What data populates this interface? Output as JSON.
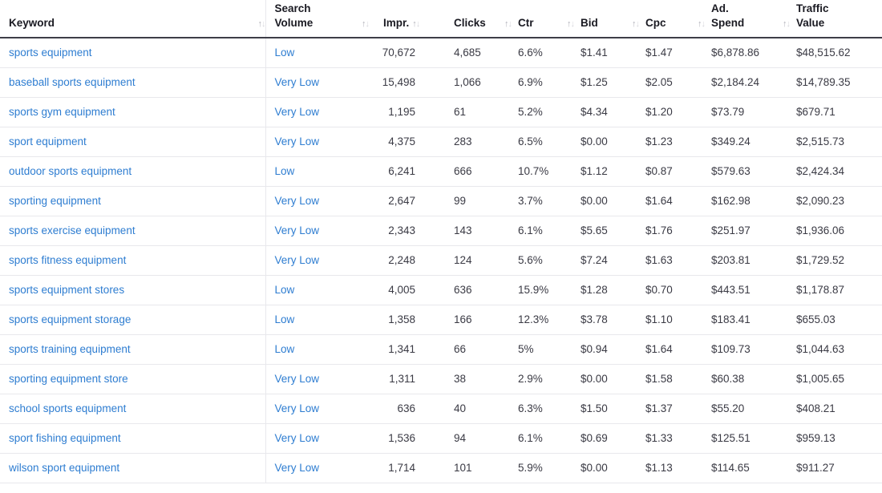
{
  "table": {
    "sort_icon": "↑↓",
    "columns": [
      {
        "key": "keyword",
        "label": "Keyword",
        "label_line1": "Keyword",
        "label_line2": ""
      },
      {
        "key": "volume",
        "label": "Search Volume",
        "label_line1": "Search",
        "label_line2": "Volume"
      },
      {
        "key": "impr",
        "label": "Impr.",
        "label_line1": "Impr.",
        "label_line2": ""
      },
      {
        "key": "clicks",
        "label": "Clicks",
        "label_line1": "Clicks",
        "label_line2": ""
      },
      {
        "key": "ctr",
        "label": "Ctr",
        "label_line1": "Ctr",
        "label_line2": ""
      },
      {
        "key": "bid",
        "label": "Bid",
        "label_line1": "Bid",
        "label_line2": ""
      },
      {
        "key": "cpc",
        "label": "Cpc",
        "label_line1": "Cpc",
        "label_line2": ""
      },
      {
        "key": "spend",
        "label": "Ad. Spend",
        "label_line1": "Ad.",
        "label_line2": "Spend"
      },
      {
        "key": "traffic",
        "label": "Traffic Value",
        "label_line1": "Traffic",
        "label_line2": "Value"
      }
    ],
    "rows": [
      {
        "keyword": "sports equipment",
        "volume": "Low",
        "impr": "70,672",
        "clicks": "4,685",
        "ctr": "6.6%",
        "bid": "$1.41",
        "cpc": "$1.47",
        "spend": "$6,878.86",
        "traffic": "$48,515.62"
      },
      {
        "keyword": "baseball sports equipment",
        "volume": "Very Low",
        "impr": "15,498",
        "clicks": "1,066",
        "ctr": "6.9%",
        "bid": "$1.25",
        "cpc": "$2.05",
        "spend": "$2,184.24",
        "traffic": "$14,789.35"
      },
      {
        "keyword": "sports gym equipment",
        "volume": "Very Low",
        "impr": "1,195",
        "clicks": "61",
        "ctr": "5.2%",
        "bid": "$4.34",
        "cpc": "$1.20",
        "spend": "$73.79",
        "traffic": "$679.71"
      },
      {
        "keyword": "sport equipment",
        "volume": "Very Low",
        "impr": "4,375",
        "clicks": "283",
        "ctr": "6.5%",
        "bid": "$0.00",
        "cpc": "$1.23",
        "spend": "$349.24",
        "traffic": "$2,515.73"
      },
      {
        "keyword": "outdoor sports equipment",
        "volume": "Low",
        "impr": "6,241",
        "clicks": "666",
        "ctr": "10.7%",
        "bid": "$1.12",
        "cpc": "$0.87",
        "spend": "$579.63",
        "traffic": "$2,424.34"
      },
      {
        "keyword": "sporting equipment",
        "volume": "Very Low",
        "impr": "2,647",
        "clicks": "99",
        "ctr": "3.7%",
        "bid": "$0.00",
        "cpc": "$1.64",
        "spend": "$162.98",
        "traffic": "$2,090.23"
      },
      {
        "keyword": "sports exercise equipment",
        "volume": "Very Low",
        "impr": "2,343",
        "clicks": "143",
        "ctr": "6.1%",
        "bid": "$5.65",
        "cpc": "$1.76",
        "spend": "$251.97",
        "traffic": "$1,936.06"
      },
      {
        "keyword": "sports fitness equipment",
        "volume": "Very Low",
        "impr": "2,248",
        "clicks": "124",
        "ctr": "5.6%",
        "bid": "$7.24",
        "cpc": "$1.63",
        "spend": "$203.81",
        "traffic": "$1,729.52"
      },
      {
        "keyword": "sports equipment stores",
        "volume": "Low",
        "impr": "4,005",
        "clicks": "636",
        "ctr": "15.9%",
        "bid": "$1.28",
        "cpc": "$0.70",
        "spend": "$443.51",
        "traffic": "$1,178.87"
      },
      {
        "keyword": "sports equipment storage",
        "volume": "Low",
        "impr": "1,358",
        "clicks": "166",
        "ctr": "12.3%",
        "bid": "$3.78",
        "cpc": "$1.10",
        "spend": "$183.41",
        "traffic": "$655.03"
      },
      {
        "keyword": "sports training equipment",
        "volume": "Low",
        "impr": "1,341",
        "clicks": "66",
        "ctr": "5%",
        "bid": "$0.94",
        "cpc": "$1.64",
        "spend": "$109.73",
        "traffic": "$1,044.63"
      },
      {
        "keyword": "sporting equipment store",
        "volume": "Very Low",
        "impr": "1,311",
        "clicks": "38",
        "ctr": "2.9%",
        "bid": "$0.00",
        "cpc": "$1.58",
        "spend": "$60.38",
        "traffic": "$1,005.65"
      },
      {
        "keyword": "school sports equipment",
        "volume": "Very Low",
        "impr": "636",
        "clicks": "40",
        "ctr": "6.3%",
        "bid": "$1.50",
        "cpc": "$1.37",
        "spend": "$55.20",
        "traffic": "$408.21"
      },
      {
        "keyword": "sport fishing equipment",
        "volume": "Very Low",
        "impr": "1,536",
        "clicks": "94",
        "ctr": "6.1%",
        "bid": "$0.69",
        "cpc": "$1.33",
        "spend": "$125.51",
        "traffic": "$959.13"
      },
      {
        "keyword": "wilson sport equipment",
        "volume": "Very Low",
        "impr": "1,714",
        "clicks": "101",
        "ctr": "5.9%",
        "bid": "$0.00",
        "cpc": "$1.13",
        "spend": "$114.65",
        "traffic": "$911.27"
      }
    ]
  },
  "colors": {
    "link": "#2e7dd1",
    "header_text": "#1a1a22",
    "body_text": "#3a3a44",
    "row_divider": "#e8e8ec",
    "header_rule": "#3d3d47"
  }
}
